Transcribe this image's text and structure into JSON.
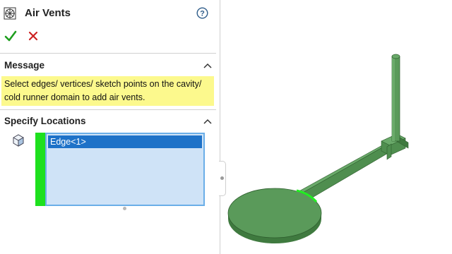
{
  "panel": {
    "title": "Air Vents",
    "ok_icon": "checkmark-icon",
    "cancel_icon": "x-icon",
    "help_icon": "question-circle-icon"
  },
  "message_section": {
    "header": "Message",
    "line1": "Select edges/ vertices/ sketch points on the cavity/",
    "line2": "cold runner domain to add air vents."
  },
  "locations_section": {
    "header": "Specify Locations",
    "items": [
      "Edge<1>"
    ]
  },
  "colors": {
    "model_green": "#5a9a5a",
    "highlight_green": "#22ee22",
    "message_yellow": "#fcf98d",
    "selection_blue": "#1e72c8"
  }
}
